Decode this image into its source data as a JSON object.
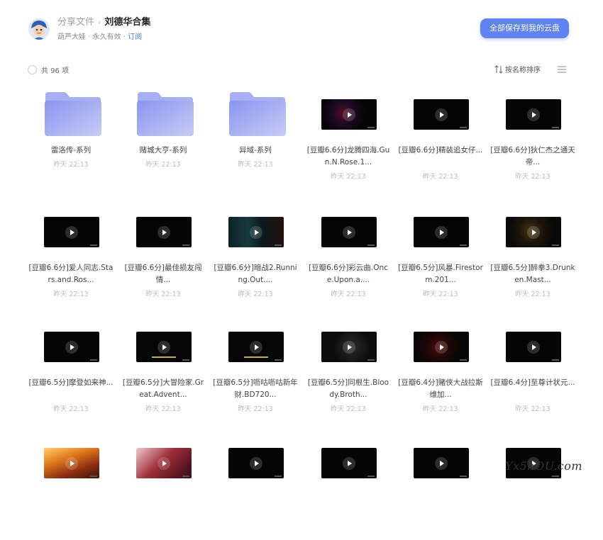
{
  "header": {
    "breadcrumb_root": "分享文件",
    "breadcrumb_separator": "›",
    "breadcrumb_current": "刘德华合集",
    "owner": "葫芦大娃",
    "validity": "永久有效",
    "subscribe": "订阅",
    "save_all_button": "全部保存到我的云盘"
  },
  "toolbar": {
    "count_label": "共 96 项",
    "sort_label": "按名称排序"
  },
  "colors": {
    "accent": "#5f83f3",
    "folder_light": "#c7ccf5",
    "folder_dark": "#8a95f0"
  },
  "items": [
    {
      "type": "folder",
      "name": "雷洛传-系列",
      "date": "昨天 22:13"
    },
    {
      "type": "folder",
      "name": "赌城大亨-系列",
      "date": "昨天 22:13"
    },
    {
      "type": "folder",
      "name": "异域-系列",
      "date": "昨天 22:13"
    },
    {
      "type": "video",
      "scene": "scene-red",
      "name": "[豆瓣6.6分]龙腾四海.Gun.N.Rose.1...",
      "date": "昨天 22:13"
    },
    {
      "type": "video",
      "scene": "",
      "name": "[豆瓣6.6分]精装追女仔...",
      "date": "昨天 22:13"
    },
    {
      "type": "video",
      "scene": "",
      "name": "[豆瓣6.6分]狄仁杰之通天帝...",
      "date": "昨天 22:13"
    },
    {
      "type": "video",
      "scene": "",
      "name": "[豆瓣6.6分]爱人同志.Stars.and.Ros...",
      "date": "昨天 22:13"
    },
    {
      "type": "video",
      "scene": "",
      "name": "[豆瓣6.6分]最佳损友闯情...",
      "date": "昨天 22:13"
    },
    {
      "type": "video",
      "scene": "scene-blue",
      "name": "[豆瓣6.6分]暗战2.Running.Out....",
      "date": "昨天 22:13"
    },
    {
      "type": "video",
      "scene": "",
      "name": "[豆瓣6.6分]彩云曲.Once.Upon.a....",
      "date": "昨天 22:13"
    },
    {
      "type": "video",
      "scene": "",
      "name": "[豆瓣6.5分]风暴.Firestorm.201...",
      "date": "昨天 22:13"
    },
    {
      "type": "video",
      "scene": "scene-gold",
      "name": "[豆瓣6.5分]醉拳3.Drunken.Mast...",
      "date": "昨天 22:13"
    },
    {
      "type": "video",
      "scene": "",
      "name": "[豆瓣6.5分]摩登如来神...",
      "date": "昨天 22:13"
    },
    {
      "type": "video",
      "scene": "scene-sub",
      "name": "[豆瓣6.5分]大冒险家.Great.Advent...",
      "date": "昨天 22:13"
    },
    {
      "type": "video",
      "scene": "scene-sub",
      "name": "[豆瓣6.5分]呖咕呖咕新年财.BD720...",
      "date": "昨天 22:13"
    },
    {
      "type": "video",
      "scene": "scene-grey",
      "name": "[豆瓣6.5分]同根生.Bloody.Broth...",
      "date": "昨天 22:13"
    },
    {
      "type": "video",
      "scene": "scene-lava",
      "name": "[豆瓣6.4分]賭侠大战拉斯维加...",
      "date": "昨天 22:13"
    },
    {
      "type": "video",
      "scene": "",
      "name": "[豆瓣6.4分]至尊计状元...",
      "date": "昨天 22:13"
    },
    {
      "type": "video",
      "scene": "scene-fire",
      "name": "",
      "date": ""
    },
    {
      "type": "video",
      "scene": "scene-rose",
      "name": "",
      "date": ""
    },
    {
      "type": "video",
      "scene": "",
      "name": "",
      "date": ""
    },
    {
      "type": "video",
      "scene": "",
      "name": "",
      "date": ""
    },
    {
      "type": "video",
      "scene": "",
      "name": "",
      "date": ""
    },
    {
      "type": "video",
      "scene": "",
      "name": "",
      "date": ""
    }
  ],
  "watermark": "Yx5hOU.com"
}
